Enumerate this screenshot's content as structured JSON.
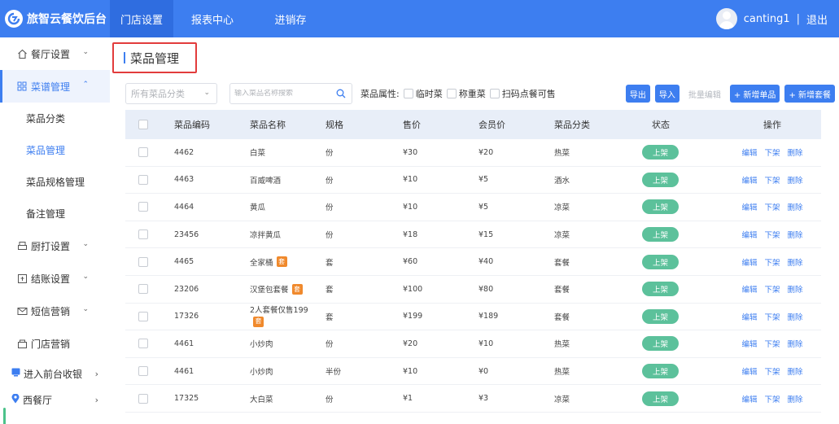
{
  "app": {
    "name": "旅智云餐饮后台",
    "nav": [
      "门店设置",
      "报表中心",
      "进销存"
    ],
    "user": "canting1",
    "separator": "|",
    "logout": "退出"
  },
  "sidebar": {
    "items": [
      {
        "label": "餐厅设置",
        "icon": "home-icon"
      },
      {
        "label": "菜谱管理",
        "icon": "grid-icon"
      },
      {
        "label": "厨打设置",
        "icon": "printer-icon"
      },
      {
        "label": "结账设置",
        "icon": "payment-icon"
      },
      {
        "label": "短信营销",
        "icon": "mail-icon"
      },
      {
        "label": "门店营销",
        "icon": "store-icon"
      }
    ],
    "sub": [
      "菜品分类",
      "菜品管理",
      "菜品规格管理",
      "备注管理"
    ],
    "bottom": [
      "进入前台收银",
      "西餐厅"
    ]
  },
  "page": {
    "title": "菜品管理",
    "filters": {
      "category_placeholder": "所有菜品分类",
      "search_placeholder": "输入菜品名称搜索",
      "attr_label": "菜品属性:",
      "attrs": [
        "临时菜",
        "称重菜",
        "扫码点餐可售"
      ]
    },
    "buttons": [
      "导出",
      "导入",
      "批量编辑",
      "+ 新增单品",
      "+ 新增套餐"
    ]
  },
  "table": {
    "headers": [
      "菜品编码",
      "菜品名称",
      "规格",
      "售价",
      "会员价",
      "菜品分类",
      "状态",
      "操作"
    ],
    "set_tag": "套",
    "status_label": "上架",
    "actions": [
      "编辑",
      "下架",
      "删除"
    ],
    "rows": [
      {
        "code": "4462",
        "name": "白菜",
        "spec": "份",
        "price": "¥30",
        "member": "¥20",
        "category": "热菜",
        "set": false
      },
      {
        "code": "4463",
        "name": "百威啤酒",
        "spec": "份",
        "price": "¥10",
        "member": "¥5",
        "category": "酒水",
        "set": false
      },
      {
        "code": "4464",
        "name": "黄瓜",
        "spec": "份",
        "price": "¥10",
        "member": "¥5",
        "category": "凉菜",
        "set": false
      },
      {
        "code": "23456",
        "name": "凉拌黄瓜",
        "spec": "份",
        "price": "¥18",
        "member": "¥15",
        "category": "凉菜",
        "set": false
      },
      {
        "code": "4465",
        "name": "全家桶",
        "spec": "套",
        "price": "¥60",
        "member": "¥40",
        "category": "套餐",
        "set": true
      },
      {
        "code": "23206",
        "name": "汉堡包套餐",
        "spec": "套",
        "price": "¥100",
        "member": "¥80",
        "category": "套餐",
        "set": true
      },
      {
        "code": "17326",
        "name": "2人套餐仅售199",
        "spec": "套",
        "price": "¥199",
        "member": "¥189",
        "category": "套餐",
        "set": true
      },
      {
        "code": "4461",
        "name": "小炒肉",
        "spec": "份",
        "price": "¥20",
        "member": "¥10",
        "category": "热菜",
        "set": false
      },
      {
        "code": "4461",
        "name": "小炒肉",
        "spec": "半份",
        "price": "¥10",
        "member": "¥0",
        "category": "热菜",
        "set": false
      },
      {
        "code": "17325",
        "name": "大白菜",
        "spec": "份",
        "price": "¥1",
        "member": "¥3",
        "category": "凉菜",
        "set": false
      }
    ]
  },
  "colors": {
    "primary": "#3d7ef0",
    "status_green": "#5cc19b",
    "set_tag": "#f0892c",
    "highlight_border": "#e23c3c"
  }
}
